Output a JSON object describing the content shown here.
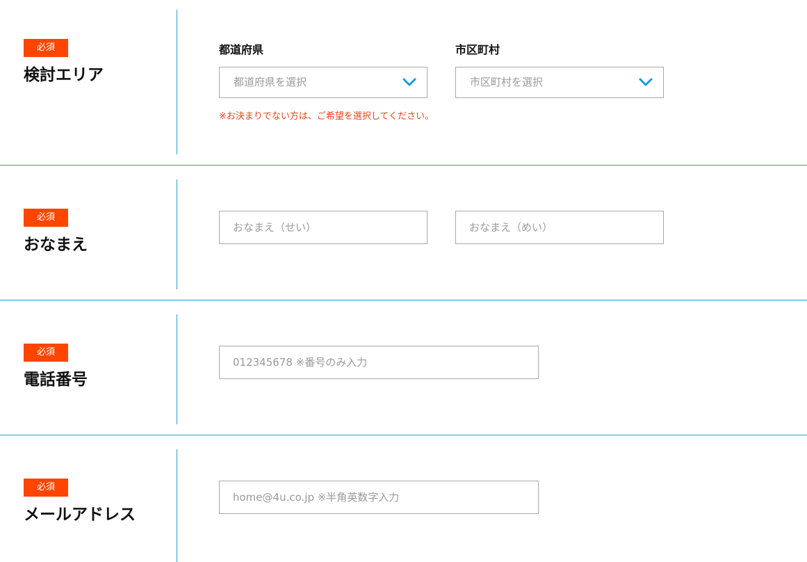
{
  "required_badge_label": "必須",
  "rows": {
    "area": {
      "label": "検討エリア",
      "prefecture": {
        "label": "都道府県",
        "selected": "都道府県を選択"
      },
      "city": {
        "label": "市区町村",
        "selected": "市区町村を選択"
      },
      "note": "※お決まりでない方は、ご希望を選択してください。"
    },
    "name": {
      "label": "おなまえ",
      "family_placeholder": "おなまえ（せい）",
      "given_placeholder": "おなまえ（めい）"
    },
    "phone": {
      "label": "電話番号",
      "placeholder": "012345678 ※番号のみ入力"
    },
    "email": {
      "label": "メールアドレス",
      "placeholder": "home@4u.co.jp ※半角英数字入力"
    }
  },
  "colors": {
    "accent": "#2a9bd0",
    "required_badge": "#ff4500",
    "note": "#e8451a",
    "chevron": "#1a9ad6"
  },
  "icons": {
    "dropdown": "chevron-down-icon"
  }
}
